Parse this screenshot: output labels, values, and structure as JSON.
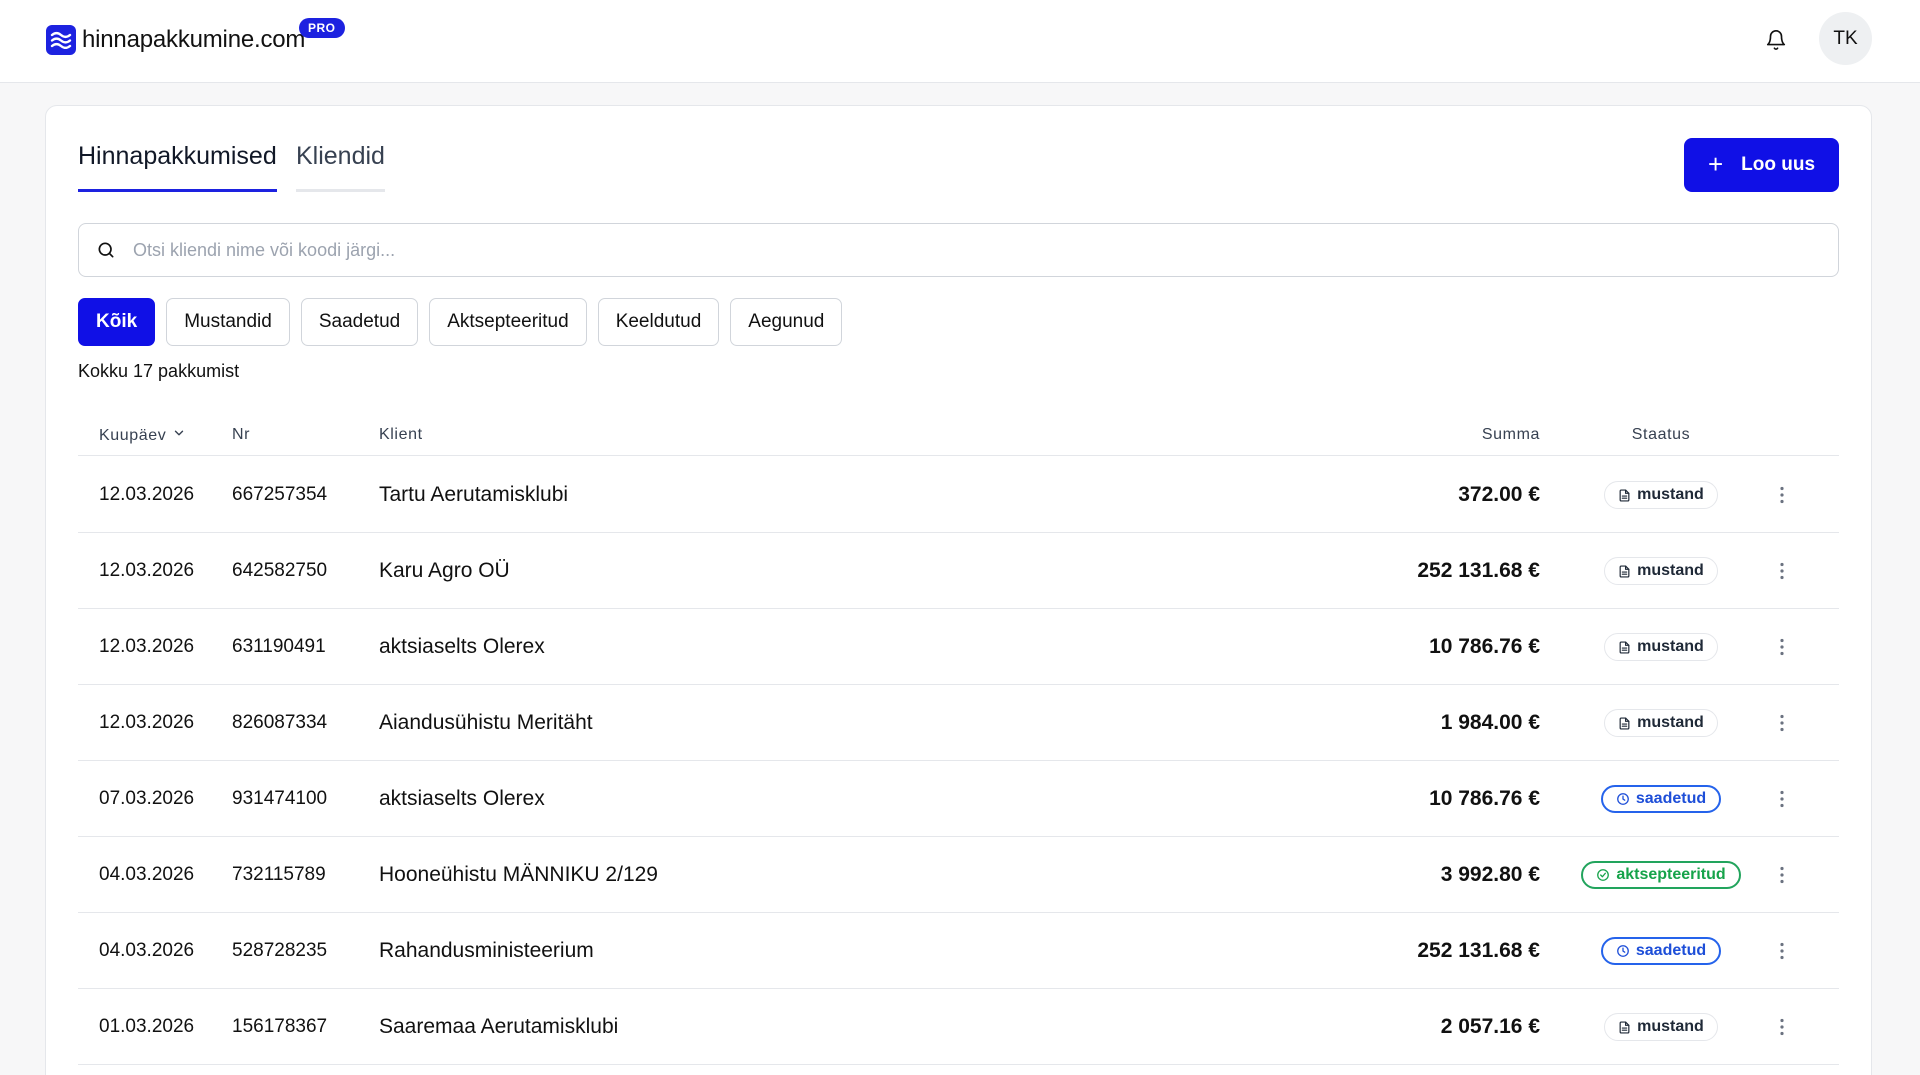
{
  "header": {
    "logo_text": "hinnapakkumine.com",
    "pro_label": "PRO",
    "avatar_initials": "TK"
  },
  "tabs": [
    {
      "label": "Hinnapakkumised",
      "active": true
    },
    {
      "label": "Kliendid",
      "active": false
    }
  ],
  "new_button": {
    "label": "Loo uus"
  },
  "search": {
    "placeholder": "Otsi kliendi nime või koodi järgi...",
    "value": ""
  },
  "filters": [
    "Kõik",
    "Mustandid",
    "Saadetud",
    "Aktsepteeritud",
    "Keeldutud",
    "Aegunud"
  ],
  "active_filter": "Kõik",
  "count_text": "Kokku 17 pakkumist",
  "table": {
    "columns": {
      "date": "Kuupäev",
      "nr": "Nr",
      "client": "Klient",
      "sum": "Summa",
      "status": "Staatus"
    },
    "rows": [
      {
        "date": "12.03.2026",
        "nr": "667257354",
        "client": "Tartu Aerutamisklubi",
        "sum": "372.00 €",
        "status": "mustand",
        "status_kind": "draft"
      },
      {
        "date": "12.03.2026",
        "nr": "642582750",
        "client": "Karu Agro OÜ",
        "sum": "252 131.68 €",
        "status": "mustand",
        "status_kind": "draft"
      },
      {
        "date": "12.03.2026",
        "nr": "631190491",
        "client": "aktsiaselts Olerex",
        "sum": "10 786.76 €",
        "status": "mustand",
        "status_kind": "draft"
      },
      {
        "date": "12.03.2026",
        "nr": "826087334",
        "client": "Aiandusühistu Meritäht",
        "sum": "1 984.00 €",
        "status": "mustand",
        "status_kind": "draft"
      },
      {
        "date": "07.03.2026",
        "nr": "931474100",
        "client": "aktsiaselts Olerex",
        "sum": "10 786.76 €",
        "status": "saadetud",
        "status_kind": "sent"
      },
      {
        "date": "04.03.2026",
        "nr": "732115789",
        "client": "Hooneühistu MÄNNIKU 2/129",
        "sum": "3 992.80 €",
        "status": "aktsepteeritud",
        "status_kind": "accepted"
      },
      {
        "date": "04.03.2026",
        "nr": "528728235",
        "client": "Rahandusministeerium",
        "sum": "252 131.68 €",
        "status": "saadetud",
        "status_kind": "sent"
      },
      {
        "date": "01.03.2026",
        "nr": "156178367",
        "client": "Saaremaa Aerutamisklubi",
        "sum": "2 057.16 €",
        "status": "mustand",
        "status_kind": "draft"
      }
    ]
  },
  "colors": {
    "brand": "#1d22e0",
    "primary_button": "#1010e6",
    "sent": "#2563eb",
    "accepted": "#16a34a"
  },
  "icons": {
    "logo": "waves-icon",
    "bell": "bell-icon",
    "search": "search-icon",
    "plus": "plus-icon",
    "sort": "chevron-down-icon",
    "draft": "document-icon",
    "sent": "clock-icon",
    "accepted": "check-circle-icon",
    "menu": "more-vertical-icon"
  }
}
